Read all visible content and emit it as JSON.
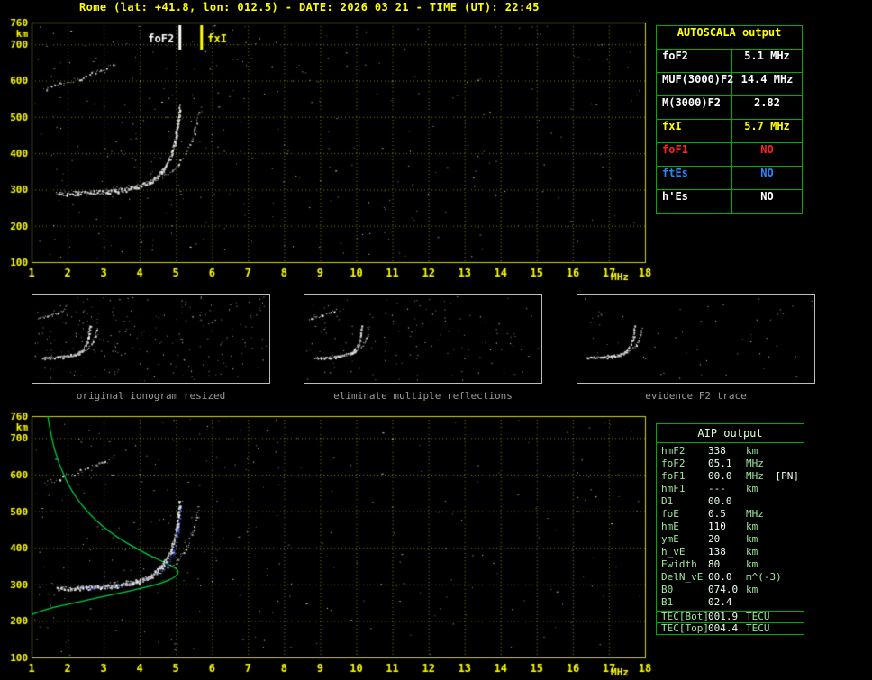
{
  "header": {
    "title": "Rome (lat: +41.8, lon: 012.5) - DATE: 2026 03 21 - TIME (UT): 22:45"
  },
  "colors": {
    "axis": "#ffff00",
    "grid": "rgba(255,255,0,0.5)",
    "table_border": "#00ab00",
    "profile_green": "#00d044",
    "fitted_blue": "#4a6cff",
    "caption_gray": "#9a9a9a"
  },
  "autoscala": {
    "title": "AUTOSCALA output",
    "rows": [
      {
        "label": "foF2",
        "value": "5.1 MHz",
        "color": "#ffffff"
      },
      {
        "label": "MUF(3000)F2",
        "value": "14.4 MHz",
        "color": "#ffffff"
      },
      {
        "label": "M(3000)F2",
        "value": "2.82",
        "color": "#ffffff"
      },
      {
        "label": "fxI",
        "value": "5.7 MHz",
        "color": "#ffff00"
      },
      {
        "label": "foF1",
        "value": "NO",
        "color": "#ff2222"
      },
      {
        "label": "ftEs",
        "value": "NO",
        "color": "#2a86ff"
      },
      {
        "label": "h'Es",
        "value": "NO",
        "color": "#ffffff"
      }
    ]
  },
  "thumbnails": [
    {
      "caption": "original ionogram resized",
      "noise_dots": 240
    },
    {
      "caption": "eliminate multiple reflections",
      "noise_dots": 130
    },
    {
      "caption": "evidence F2 trace",
      "noise_dots": 55
    }
  ],
  "aip": {
    "title": "AIP output",
    "rows": [
      {
        "label": "hmF2",
        "value": "338",
        "unit": "km",
        "extra": ""
      },
      {
        "label": "foF2",
        "value": "05.1",
        "unit": "MHz",
        "extra": ""
      },
      {
        "label": "foF1",
        "value": "00.0",
        "unit": "MHz",
        "extra": "[PN]"
      },
      {
        "label": "hmF1",
        "value": "---",
        "unit": "km",
        "extra": ""
      },
      {
        "label": "D1",
        "value": "00.0",
        "unit": "",
        "extra": ""
      },
      {
        "label": "foE",
        "value": "0.5",
        "unit": "MHz",
        "extra": ""
      },
      {
        "label": "hmE",
        "value": "110",
        "unit": "km",
        "extra": ""
      },
      {
        "label": "ymE",
        "value": "20",
        "unit": "km",
        "extra": ""
      },
      {
        "label": "h_vE",
        "value": "138",
        "unit": "km",
        "extra": ""
      },
      {
        "label": "Ewidth",
        "value": "80",
        "unit": "km",
        "extra": ""
      },
      {
        "label": "DelN_vE",
        "value": "00.0",
        "unit": "m^(-3)",
        "extra": ""
      },
      {
        "label": "B0",
        "value": "074.0",
        "unit": "km",
        "extra": ""
      },
      {
        "label": "B1",
        "value": "02.4",
        "unit": "",
        "extra": ""
      }
    ],
    "tec_rows": [
      {
        "label": "TEC[Bot]",
        "value": "001.9",
        "unit": "TECU"
      },
      {
        "label": "TEC[Top]",
        "value": "004.4",
        "unit": "TECU"
      }
    ]
  },
  "chart_data": [
    {
      "id": "ionogram-top",
      "type": "scatter",
      "title": "recorded ionogram",
      "xlabel": "MHz",
      "ylabel": "km",
      "xlim": [
        1,
        18
      ],
      "ylim": [
        100,
        760
      ],
      "xticks": [
        1,
        2,
        3,
        4,
        5,
        6,
        7,
        8,
        9,
        10,
        11,
        12,
        13,
        14,
        15,
        16,
        17,
        18
      ],
      "yticks": [
        760,
        700,
        600,
        500,
        400,
        300,
        200,
        100
      ],
      "grid": true,
      "seed": 7,
      "noise_dots": 330,
      "markers": [
        {
          "label": "foF2",
          "freq_mhz": 5.1,
          "color": "#ffffff",
          "label_side": "left"
        },
        {
          "label": "fxI",
          "freq_mhz": 5.7,
          "color": "#ffff00",
          "label_side": "right"
        }
      ],
      "traces": [
        {
          "name": "f2-ordinary-echo",
          "color": "white",
          "points": [
            [
              1.7,
              288
            ],
            [
              2.2,
              291
            ],
            [
              2.8,
              293
            ],
            [
              3.4,
              297
            ],
            [
              3.9,
              307
            ],
            [
              4.3,
              323
            ],
            [
              4.6,
              350
            ],
            [
              4.85,
              390
            ],
            [
              5.0,
              445
            ],
            [
              5.07,
              500
            ],
            [
              5.1,
              528
            ]
          ]
        },
        {
          "name": "f2-extraordinary-echo",
          "color": "white",
          "points": [
            [
              3.0,
              301
            ],
            [
              3.6,
              306
            ],
            [
              4.1,
              316
            ],
            [
              4.6,
              334
            ],
            [
              5.0,
              362
            ],
            [
              5.3,
              403
            ],
            [
              5.5,
              458
            ],
            [
              5.63,
              515
            ]
          ]
        },
        {
          "name": "multiple-reflection-echo",
          "color": "white",
          "points": [
            [
              1.35,
              575
            ],
            [
              1.8,
              592
            ],
            [
              2.3,
              608
            ],
            [
              2.8,
              625
            ],
            [
              3.3,
              648
            ]
          ]
        }
      ]
    },
    {
      "id": "ionogram-bottom",
      "type": "scatter",
      "title": "scaled ionogram with electron density profile",
      "xlabel": "MHz",
      "ylabel": "km",
      "xlim": [
        1,
        18
      ],
      "ylim": [
        100,
        760
      ],
      "xticks": [
        1,
        2,
        3,
        4,
        5,
        6,
        7,
        8,
        9,
        10,
        11,
        12,
        13,
        14,
        15,
        16,
        17,
        18
      ],
      "yticks": [
        760,
        700,
        600,
        500,
        400,
        300,
        200,
        100
      ],
      "grid": true,
      "seed": 11,
      "noise_dots": 270,
      "markers": [],
      "profile": {
        "name": "electron-density-profile",
        "color": "#00d044",
        "points": [
          [
            1.45,
            760
          ],
          [
            1.55,
            700
          ],
          [
            1.75,
            630
          ],
          [
            2.1,
            555
          ],
          [
            2.6,
            490
          ],
          [
            3.3,
            432
          ],
          [
            4.2,
            382
          ],
          [
            4.8,
            355
          ],
          [
            5.1,
            338
          ],
          [
            5.0,
            320
          ],
          [
            4.6,
            303
          ],
          [
            3.9,
            286
          ],
          [
            3.0,
            267
          ],
          [
            2.1,
            248
          ],
          [
            1.4,
            232
          ],
          [
            1.02,
            218
          ]
        ]
      },
      "fitted_trace": {
        "name": "autoscala-fitted-trace",
        "color": "#4a6cff",
        "points": [
          [
            2.3,
            292
          ],
          [
            3.0,
            295
          ],
          [
            3.6,
            300
          ],
          [
            4.1,
            312
          ],
          [
            4.5,
            332
          ],
          [
            4.8,
            362
          ],
          [
            5.0,
            405
          ],
          [
            5.08,
            460
          ],
          [
            5.1,
            515
          ]
        ]
      },
      "traces": [
        {
          "name": "f2-ordinary-echo",
          "color": "white",
          "points": [
            [
              1.7,
              288
            ],
            [
              2.2,
              291
            ],
            [
              2.8,
              293
            ],
            [
              3.4,
              297
            ],
            [
              3.9,
              307
            ],
            [
              4.3,
              323
            ],
            [
              4.6,
              350
            ],
            [
              4.85,
              390
            ],
            [
              5.0,
              445
            ],
            [
              5.07,
              500
            ],
            [
              5.1,
              528
            ]
          ]
        },
        {
          "name": "f2-extraordinary-echo",
          "color": "white",
          "points": [
            [
              3.0,
              301
            ],
            [
              3.6,
              306
            ],
            [
              4.1,
              316
            ],
            [
              4.6,
              334
            ],
            [
              5.0,
              362
            ],
            [
              5.3,
              403
            ],
            [
              5.5,
              458
            ],
            [
              5.63,
              515
            ]
          ]
        },
        {
          "name": "multiple-reflection-echo",
          "color": "white",
          "points": [
            [
              1.35,
              575
            ],
            [
              1.8,
              592
            ],
            [
              2.3,
              608
            ],
            [
              2.8,
              625
            ],
            [
              3.3,
              648
            ]
          ]
        }
      ]
    }
  ]
}
